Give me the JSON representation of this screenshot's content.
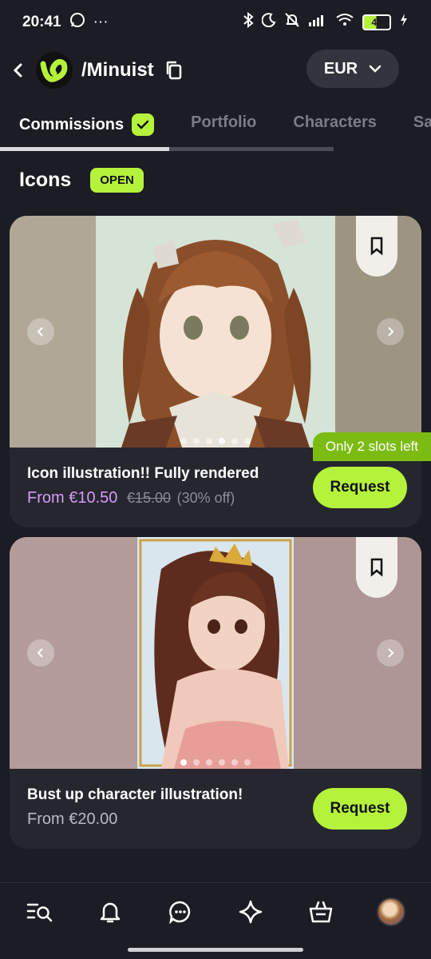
{
  "status": {
    "time": "20:41",
    "battery": "48",
    "dots": "···"
  },
  "header": {
    "shop_name": "/Minuist",
    "currency": "EUR"
  },
  "tabs": [
    {
      "label": "Commissions"
    },
    {
      "label": "Portfolio"
    },
    {
      "label": "Characters"
    },
    {
      "label": "Sa"
    }
  ],
  "section": {
    "title": "Icons",
    "badge": "OPEN"
  },
  "cards": [
    {
      "title": "Icon illustration!! Fully rendered",
      "price": "From €10.50",
      "old_price": "€15.00",
      "discount": "(30% off)",
      "request": "Request",
      "slots": "Only 2 slots left"
    },
    {
      "title": "Bust up character illustration!",
      "price": "From €20.00",
      "request": "Request"
    }
  ],
  "colors": {
    "accent": "#b5f23c",
    "price": "#d59cf5",
    "background": "#1c1c24",
    "card": "#26262f"
  },
  "nav_icons": [
    "search-list-icon",
    "bell-icon",
    "chat-icon",
    "sparkle-icon",
    "basket-icon",
    "avatar"
  ]
}
